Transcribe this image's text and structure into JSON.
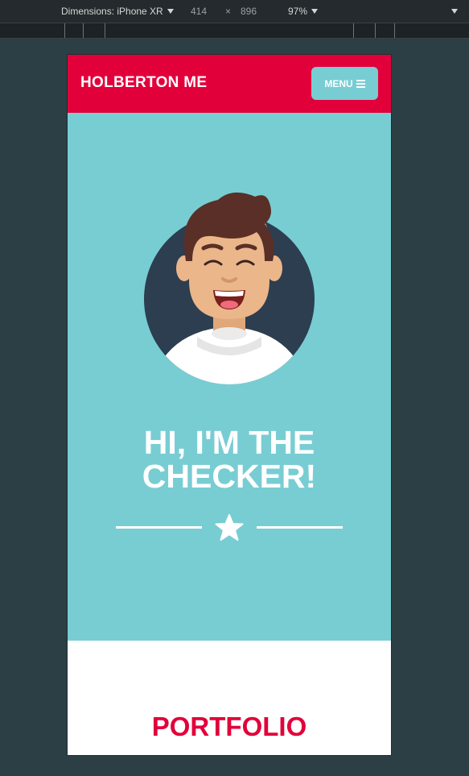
{
  "devtools": {
    "device": "Dimensions: iPhone XR",
    "width": "414",
    "times": "×",
    "height": "896",
    "zoom": "97%"
  },
  "navbar": {
    "brand": "HOLBERTON ME",
    "menu_label": "MENU"
  },
  "hero": {
    "title_line1": "HI, I'M THE",
    "title_line2": "CHECKER!"
  },
  "section": {
    "title": "PORTFOLIO"
  },
  "colors": {
    "primary": "#e2003b",
    "accent": "#78cdd3",
    "avatar_bg": "#2c3e50"
  }
}
